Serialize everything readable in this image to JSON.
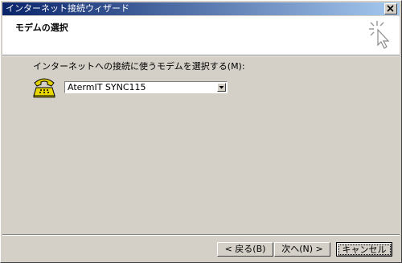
{
  "window": {
    "title": "インターネット接続ウィザード"
  },
  "header": {
    "title": "モデムの選択"
  },
  "main": {
    "prompt": "インターネットへの接続に使うモデムを選択する(M):",
    "modem_select": {
      "value": "AtermIT SYNC115"
    }
  },
  "buttons": {
    "back": "< 戻る(B)",
    "next": "次へ(N) >",
    "cancel": "キャンセル"
  },
  "icons": {
    "close": "close-icon",
    "wizard": "wizard-sparkle-icon",
    "phone": "telephone-icon",
    "dropdown": "chevron-down-icon"
  }
}
